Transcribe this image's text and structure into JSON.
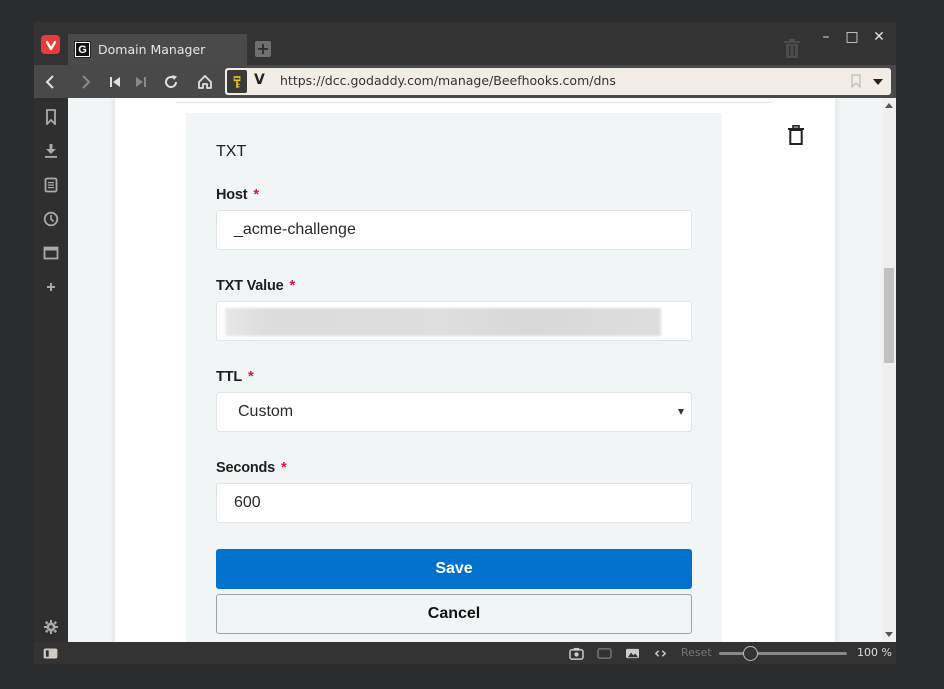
{
  "browser": {
    "tab_title": "Domain Manager",
    "tab_favicon_letter": "G",
    "url": "https://dcc.godaddy.com/manage/Beefhooks.com/dns",
    "window_controls": {
      "minimize": "–",
      "maximize": "□",
      "close": "✕"
    },
    "nav_icons": [
      "back-icon",
      "forward-icon",
      "rewind-icon",
      "fast-forward-icon",
      "reload-icon",
      "home-icon",
      "key-icon",
      "vivaldi-v-icon"
    ],
    "panel_icons": [
      "bookmarks-icon",
      "downloads-icon",
      "notes-icon",
      "history-icon",
      "window-icon",
      "add-panel-icon",
      "settings-icon"
    ]
  },
  "form": {
    "record_type": "TXT",
    "host": {
      "label": "Host",
      "required": "*",
      "value": "_acme-challenge"
    },
    "txt_value": {
      "label": "TXT Value",
      "required": "*",
      "value": ""
    },
    "ttl": {
      "label": "TTL",
      "required": "*",
      "selected": "Custom"
    },
    "seconds": {
      "label": "Seconds",
      "required": "*",
      "value": "600"
    },
    "save_label": "Save",
    "cancel_label": "Cancel"
  },
  "statusbar": {
    "reset_label": "Reset",
    "zoom_value": "100 %",
    "zoom_percent": 100
  },
  "colors": {
    "primary_button": "#0072ce",
    "required_marker": "#e0123b",
    "vivaldi_red": "#ef3939"
  }
}
